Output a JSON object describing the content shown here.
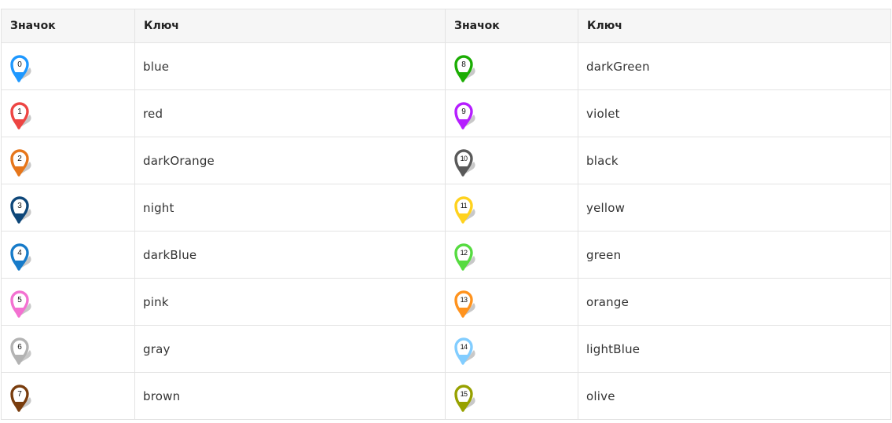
{
  "headers": {
    "icon": "Значок",
    "key": "Ключ"
  },
  "left": [
    {
      "number": "0",
      "key": "blue",
      "color": "#1e98ff"
    },
    {
      "number": "1",
      "key": "red",
      "color": "#ed4543"
    },
    {
      "number": "2",
      "key": "darkOrange",
      "color": "#e6761b"
    },
    {
      "number": "3",
      "key": "night",
      "color": "#0e4779"
    },
    {
      "number": "4",
      "key": "darkBlue",
      "color": "#177bc9"
    },
    {
      "number": "5",
      "key": "pink",
      "color": "#f371d1"
    },
    {
      "number": "6",
      "key": "gray",
      "color": "#b3b3b3"
    },
    {
      "number": "7",
      "key": "brown",
      "color": "#793d0e"
    }
  ],
  "right": [
    {
      "number": "8",
      "key": "darkGreen",
      "color": "#1bad03"
    },
    {
      "number": "9",
      "key": "violet",
      "color": "#b51eff"
    },
    {
      "number": "10",
      "key": "black",
      "color": "#595959"
    },
    {
      "number": "11",
      "key": "yellow",
      "color": "#ffd21e"
    },
    {
      "number": "12",
      "key": "green",
      "color": "#56db40"
    },
    {
      "number": "13",
      "key": "orange",
      "color": "#ff931e"
    },
    {
      "number": "14",
      "key": "lightBlue",
      "color": "#82cdff"
    },
    {
      "number": "15",
      "key": "olive",
      "color": "#97a100"
    }
  ]
}
